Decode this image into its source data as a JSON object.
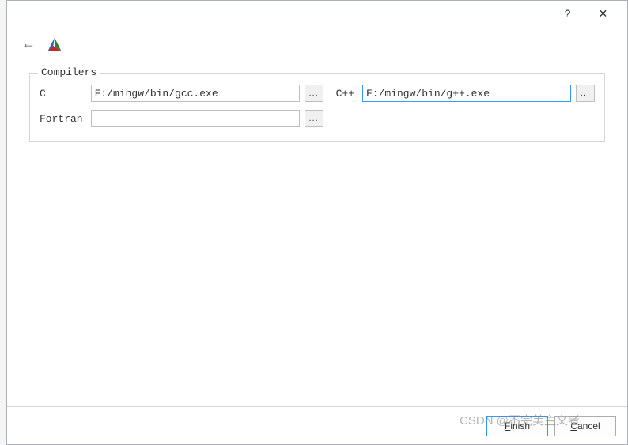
{
  "titlebar": {
    "help_symbol": "?",
    "close_symbol": "✕"
  },
  "compilers": {
    "legend": "Compilers",
    "c_label": "C",
    "c_value": "F:/mingw/bin/gcc.exe",
    "c_browse": "...",
    "cpp_label": "C++",
    "cpp_value": "F:/mingw/bin/g++.exe",
    "cpp_browse": "...",
    "fortran_label": "Fortran",
    "fortran_value": "",
    "fortran_browse": "..."
  },
  "buttons": {
    "finish_mnemonic": "F",
    "finish_rest": "inish",
    "cancel_mnemonic": "C",
    "cancel_rest": "ancel"
  },
  "watermark": "CSDN @不完美主义者"
}
